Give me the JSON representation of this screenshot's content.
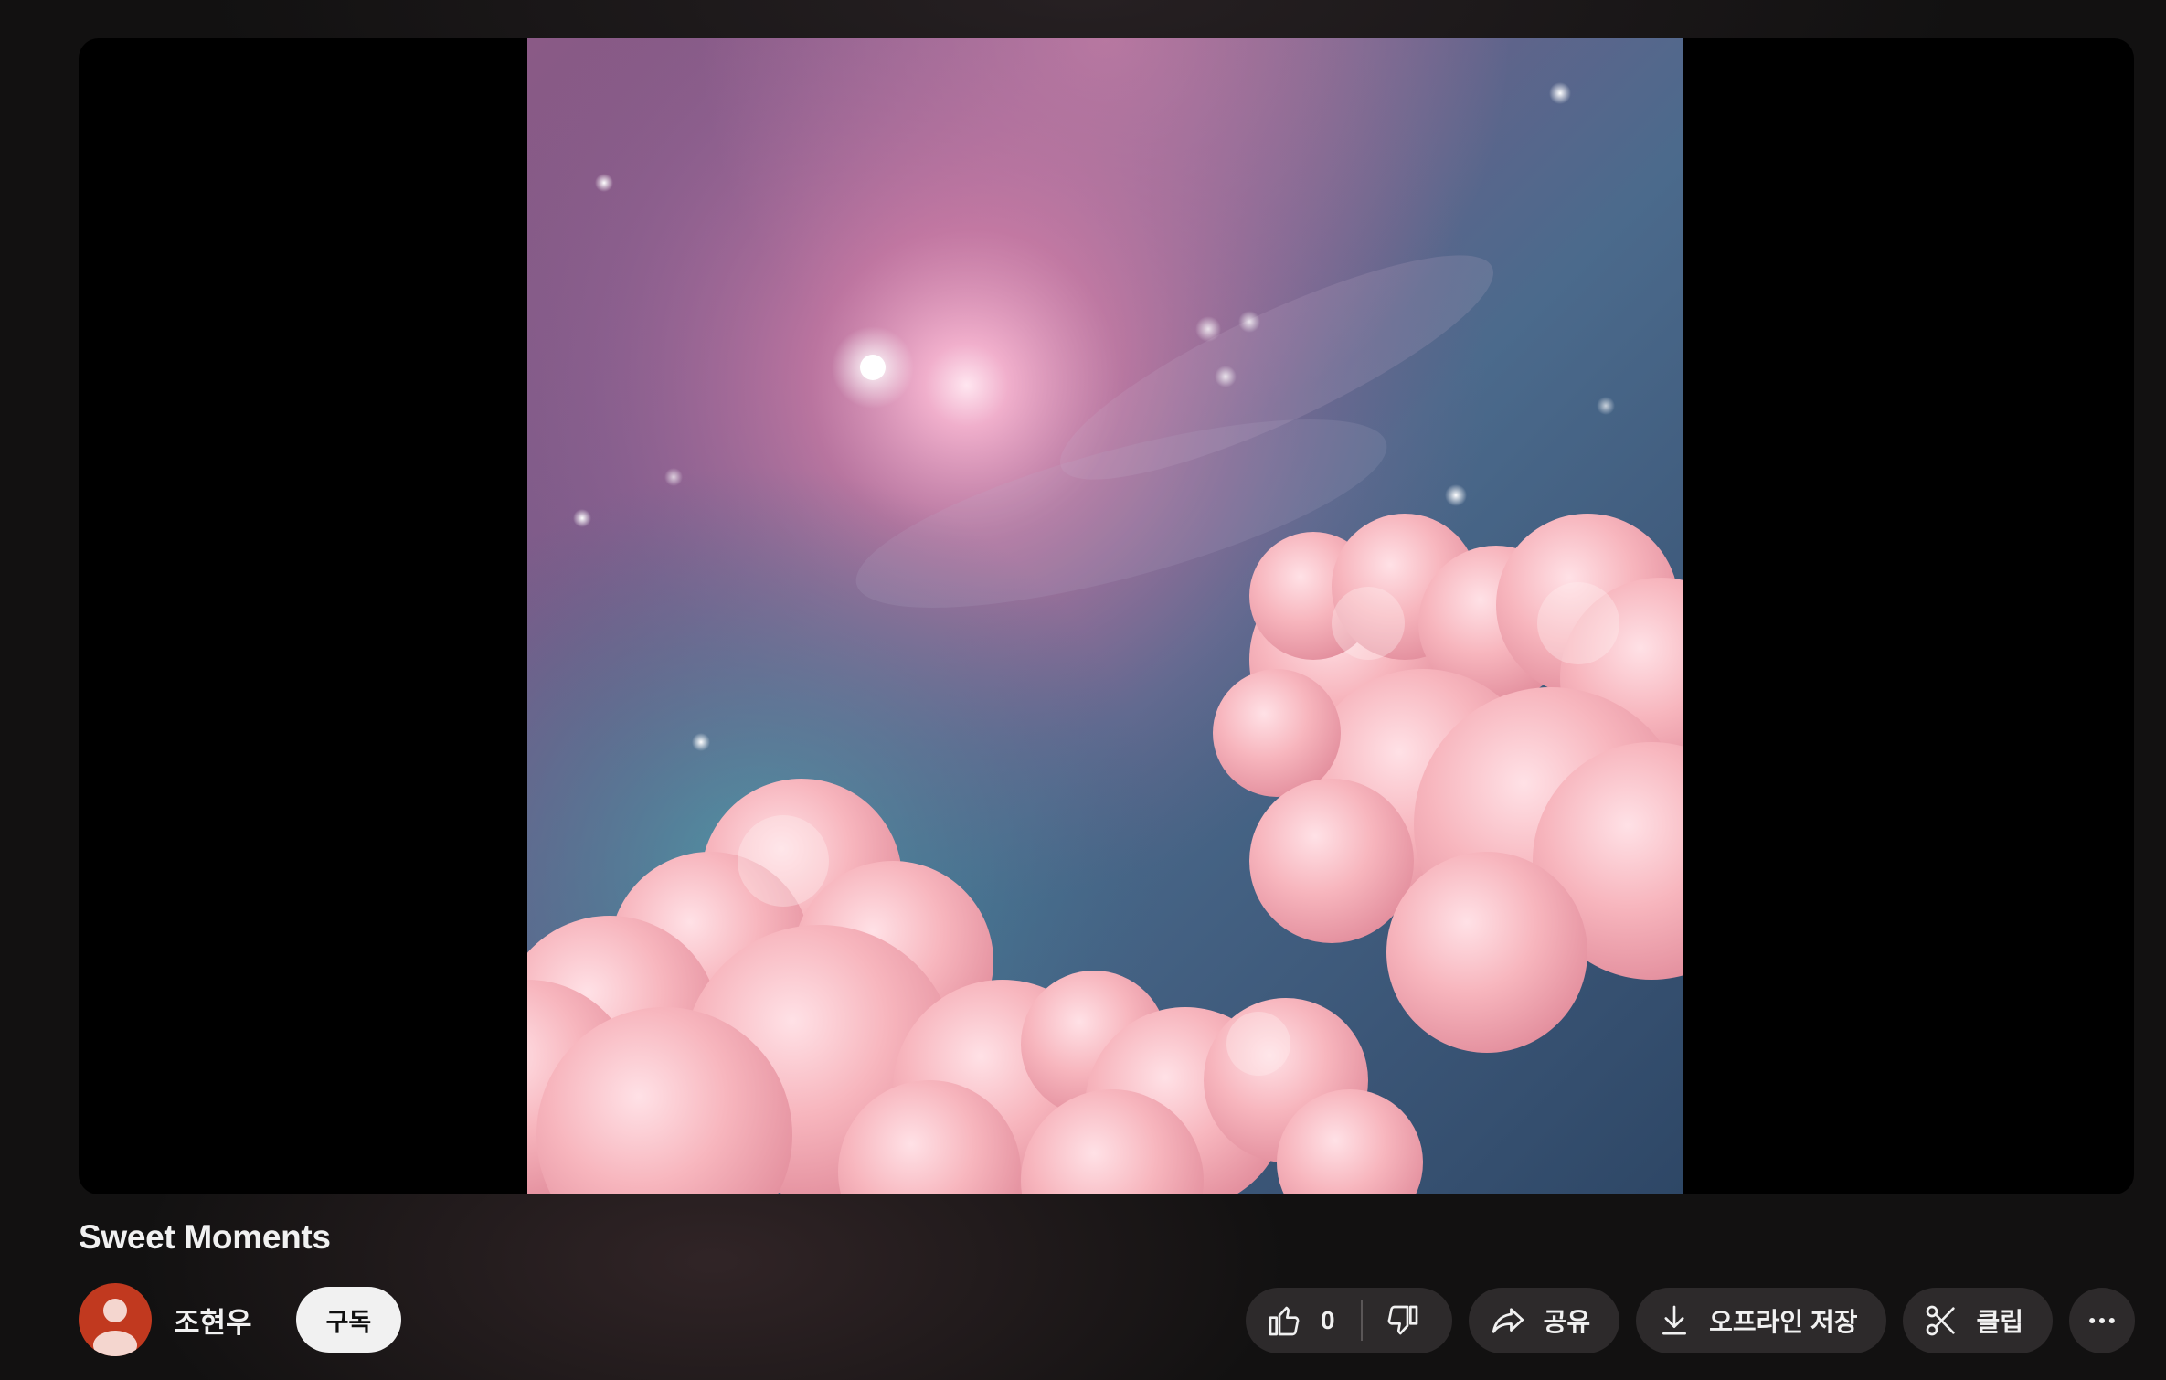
{
  "video": {
    "title": "Sweet Moments"
  },
  "channel": {
    "name": "조현우",
    "subscribe_label": "구독"
  },
  "actions": {
    "like_count": "0",
    "share_label": "공유",
    "download_label": "오프라인 저장",
    "clip_label": "클립"
  },
  "icons": {
    "like": "thumbs-up-icon",
    "dislike": "thumbs-down-icon",
    "share": "share-arrow-icon",
    "download": "download-icon",
    "clip": "scissors-icon",
    "more": "more-horizontal-icon"
  },
  "colors": {
    "background": "#0f0f0f",
    "pill": "#2d2a2b",
    "subscribe_bg": "#f1f1f1",
    "avatar": "#c1391f"
  }
}
